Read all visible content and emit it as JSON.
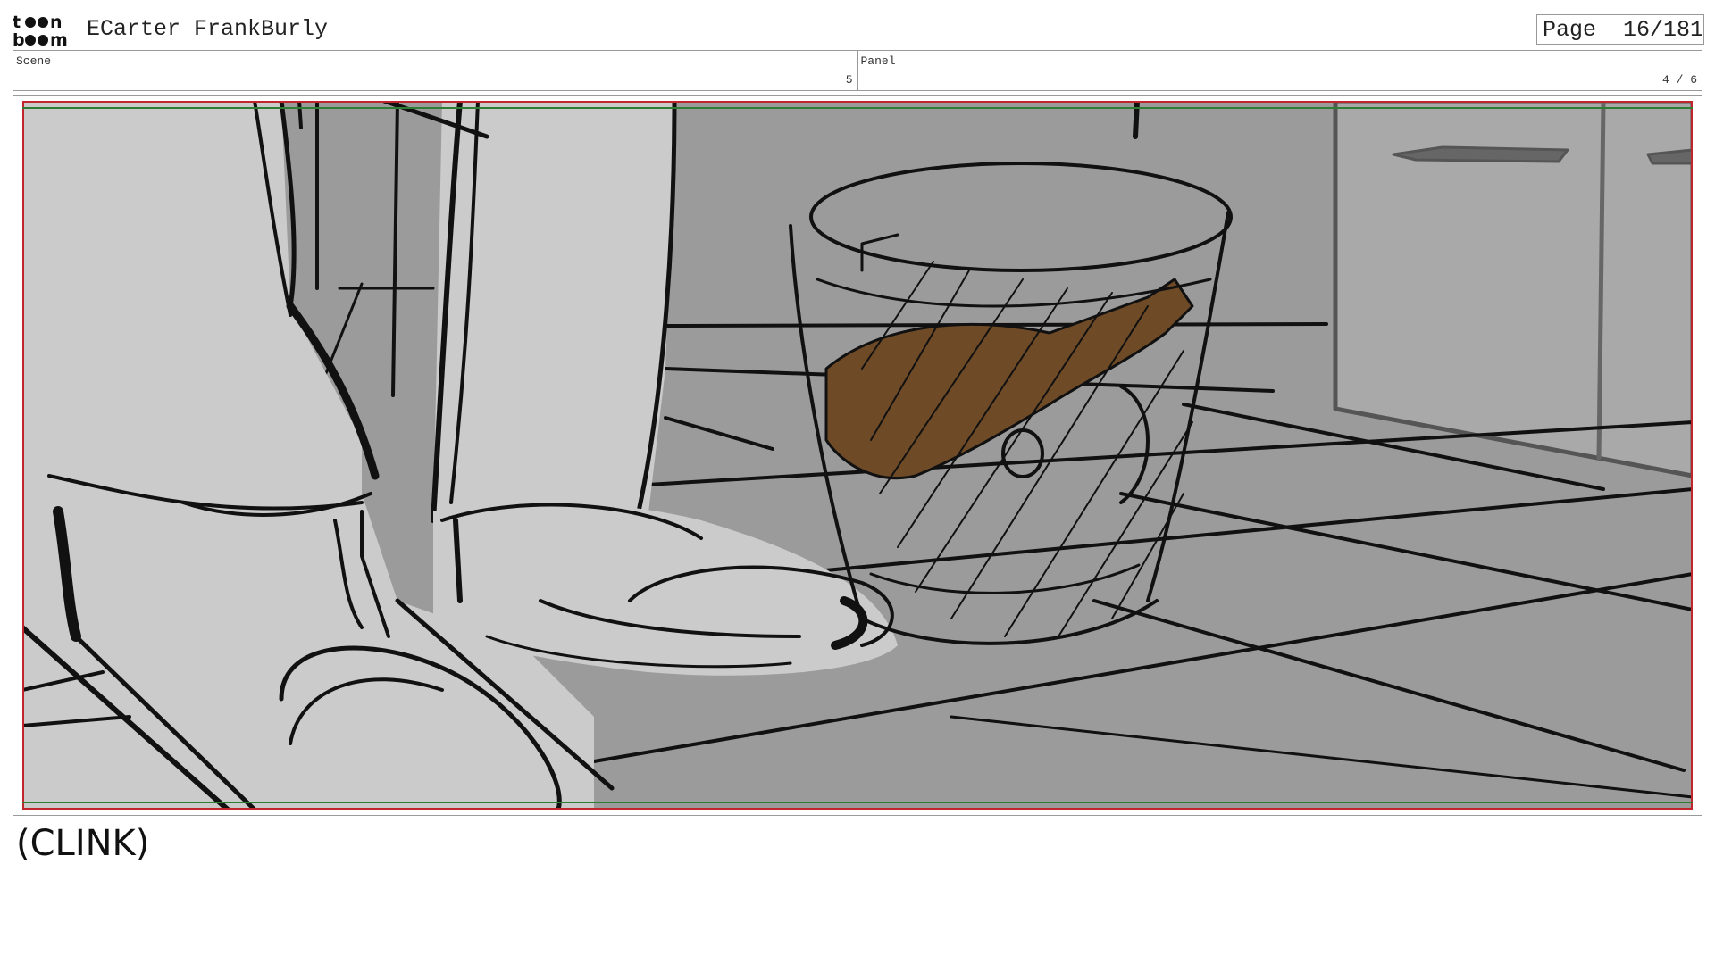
{
  "header": {
    "logo_text": "toon boom",
    "project_title": "ECarter FrankBurly",
    "page_label": "Page",
    "page_number": "16/181"
  },
  "info": {
    "scene_label": "Scene",
    "scene_value": "5",
    "panel_label": "Panel",
    "panel_value": "4 / 6"
  },
  "panel": {
    "safe_frame_color": "#c0262c",
    "title_safe_color": "#2e7d32",
    "bottle_color": "#6e4a26",
    "background_gray": "#9b9b9b",
    "foreground_light_gray": "#cbcbcb"
  },
  "dialogue": {
    "text": "(CLINK)"
  }
}
